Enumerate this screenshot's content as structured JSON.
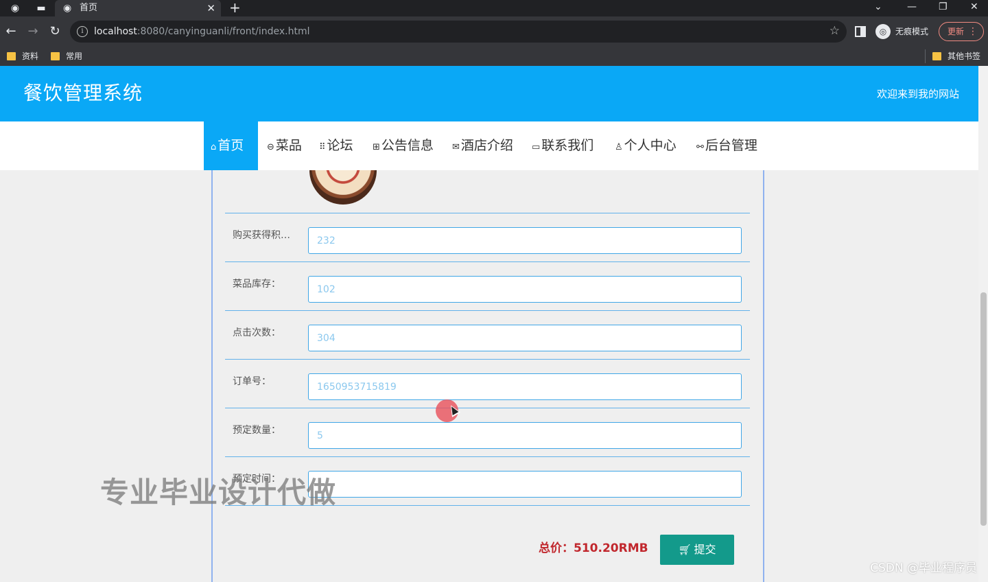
{
  "browser": {
    "tab_title": "首页",
    "url_host": "localhost",
    "url_rest": ":8080/canyinguanli/front/index.html",
    "incognito_label": "无痕模式",
    "update_label": "更新",
    "bookmarks": [
      "资料",
      "常用"
    ],
    "other_bookmarks": "其他书签"
  },
  "header": {
    "title": "餐饮管理系统",
    "welcome": "欢迎来到我的网站"
  },
  "nav": {
    "items": [
      {
        "icon": "home-icon",
        "label": "首页",
        "active": true
      },
      {
        "icon": "dish-icon",
        "label": "菜品"
      },
      {
        "icon": "forum-icon",
        "label": "论坛"
      },
      {
        "icon": "notice-icon",
        "label": "公告信息"
      },
      {
        "icon": "mail-icon",
        "label": "酒店介绍"
      },
      {
        "icon": "book-icon",
        "label": "联系我们"
      },
      {
        "icon": "user-icon",
        "label": "个人中心"
      },
      {
        "icon": "link-icon",
        "label": "后台管理"
      }
    ]
  },
  "form": {
    "fields": [
      {
        "label": "购买获得积分：",
        "value": "232"
      },
      {
        "label": "菜品库存：",
        "value": "102"
      },
      {
        "label": "点击次数：",
        "value": "304"
      },
      {
        "label": "订单号：",
        "value": "1650953715819"
      },
      {
        "label": "预定数量：",
        "value": "5"
      },
      {
        "label": "预定时间：",
        "value": ""
      }
    ],
    "total": "总价：510.20RMB",
    "submit_label": "提交"
  },
  "overlay": {
    "watermark": "专业毕业设计代做",
    "csdn": "CSDN @毕业程序员"
  },
  "colors": {
    "brand": "#0aa8f6",
    "submit": "#139a8b",
    "total": "#c1272d"
  }
}
